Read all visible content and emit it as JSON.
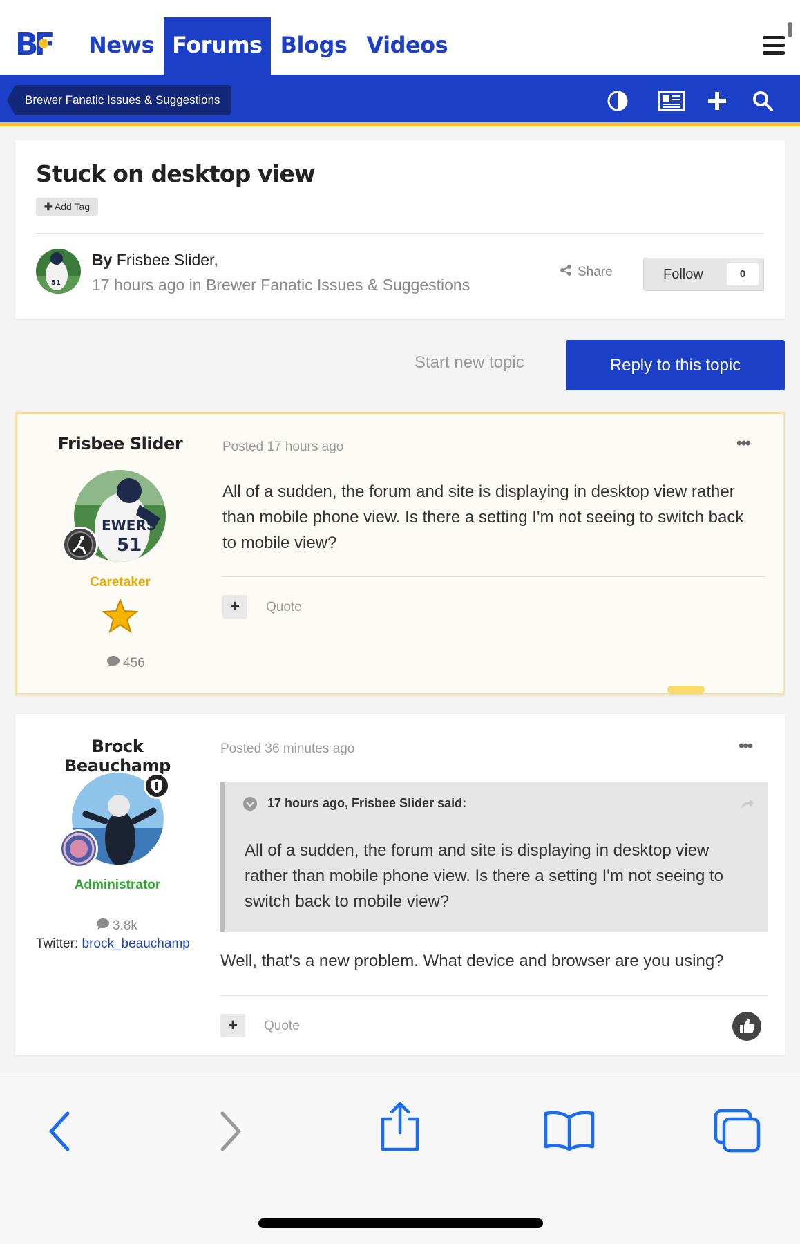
{
  "nav": {
    "logo_text": "BF",
    "links": [
      "News",
      "Forums",
      "Blogs",
      "Videos"
    ],
    "active": "Forums"
  },
  "bluebar": {
    "breadcrumb": "Brewer Fanatic Issues & Suggestions",
    "icons": [
      "contrast-icon",
      "newspaper-icon",
      "plus-icon",
      "search-icon"
    ]
  },
  "topic": {
    "title": "Stuck on desktop view",
    "add_tag": "Add Tag",
    "by_prefix": "By",
    "author": "Frisbee Slider,",
    "meta": "17 hours ago in Brewer Fanatic Issues & Suggestions",
    "share": "Share",
    "follow_label": "Follow",
    "follow_count": "0"
  },
  "actions": {
    "start_new": "Start new topic",
    "reply": "Reply to this topic"
  },
  "posts": [
    {
      "author": "Frisbee Slider",
      "posted": "Posted 17 hours ago",
      "group": "Caretaker",
      "group_color": "#e8a900",
      "post_count": "456",
      "body": "All of a sudden, the forum and site is displaying in desktop view rather than mobile phone view. Is there a setting I'm not seeing to switch back to mobile view?",
      "quote_label": "Quote"
    },
    {
      "author": "Brock Beauchamp",
      "posted": "Posted 36 minutes ago",
      "group": "Administrator",
      "group_color": "#2fa82f",
      "post_count": "3.8k",
      "twitter_label": "Twitter:",
      "twitter_handle": "brock_beauchamp",
      "quote_head": "17 hours ago, Frisbee Slider said:",
      "quote_body": "All of a sudden, the forum and site is displaying in desktop view rather than mobile phone view. Is there a setting I'm not seeing to switch back to mobile view?",
      "body": "Well, that's a new problem. What device and browser are you using?",
      "quote_label": "Quote"
    }
  ],
  "colors": {
    "brand_blue": "#1b3fc6",
    "brand_yellow": "#f7c325"
  }
}
